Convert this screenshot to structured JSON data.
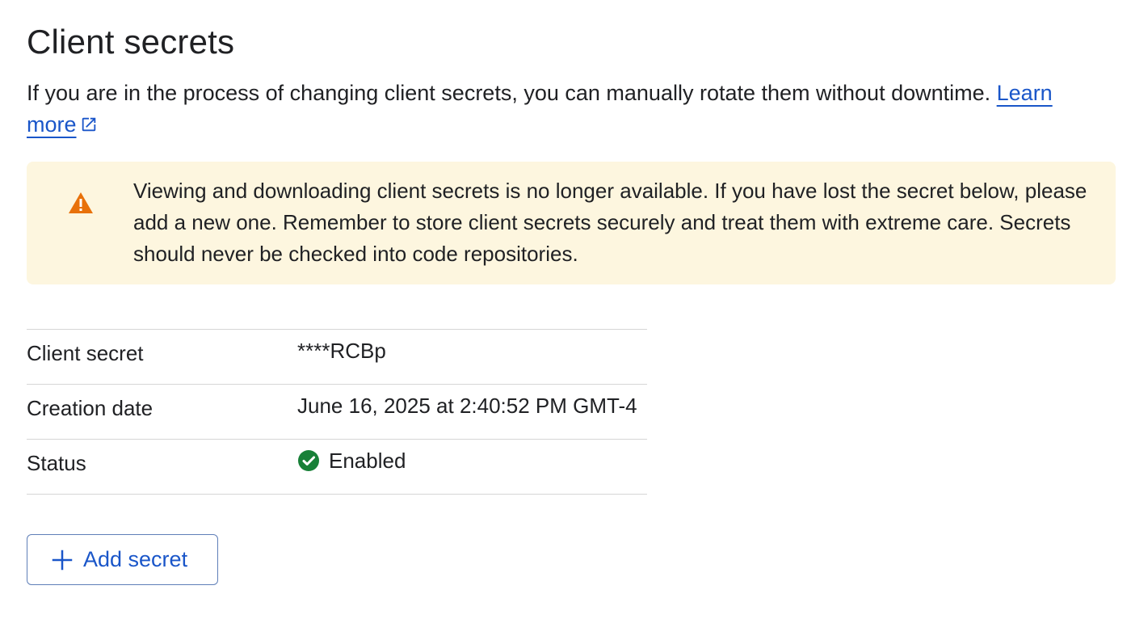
{
  "page": {
    "title": "Client secrets",
    "intro": "If you are in the process of changing client secrets, you can manually rotate them without downtime. ",
    "learn_more": "Learn more"
  },
  "warning": {
    "icon": "warning-icon",
    "text": "Viewing and downloading client secrets is no longer available. If you have lost the secret below, please add a new one. Remember to store client secrets securely and treat them with extreme care. Secrets should never be checked into code repositories.",
    "background_color": "#fdf6df",
    "icon_color": "#e8710a"
  },
  "details": {
    "rows": [
      {
        "label": "Client secret",
        "value": "****RCBp"
      },
      {
        "label": "Creation date",
        "value": "June 16, 2025 at 2:40:52 PM GMT-4"
      },
      {
        "label": "Status",
        "value": "Enabled",
        "icon": "check-circle-icon"
      }
    ]
  },
  "actions": {
    "add_secret_label": "Add secret"
  },
  "colors": {
    "link": "#1a56c9",
    "success": "#188038",
    "text": "#202124"
  }
}
